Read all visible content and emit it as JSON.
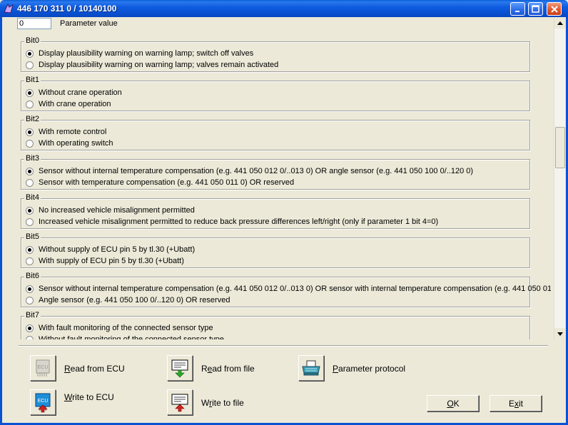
{
  "window": {
    "title": "446 170 311 0 / 10140100"
  },
  "parameter": {
    "value": "0",
    "label": "Parameter value"
  },
  "bits": [
    {
      "title": "Bit0",
      "options": [
        {
          "label": "Display plausibility warning on warning lamp; switch off valves",
          "selected": true
        },
        {
          "label": "Display plausibility warning on warning lamp; valves remain activated",
          "selected": false
        }
      ]
    },
    {
      "title": "Bit1",
      "options": [
        {
          "label": "Without crane operation",
          "selected": true
        },
        {
          "label": "With crane operation",
          "selected": false
        }
      ]
    },
    {
      "title": "Bit2",
      "options": [
        {
          "label": "With remote control",
          "selected": true
        },
        {
          "label": "With operating switch",
          "selected": false
        }
      ]
    },
    {
      "title": "Bit3",
      "options": [
        {
          "label": "Sensor without internal temperature compensation (e.g. 441 050 012 0/..013 0) OR angle sensor (e.g. 441 050 100 0/..120 0)",
          "selected": true
        },
        {
          "label": "Sensor with temperature compensation (e.g. 441 050 011 0) OR reserved",
          "selected": false
        }
      ]
    },
    {
      "title": "Bit4",
      "options": [
        {
          "label": "No increased vehicle misalignment permitted",
          "selected": true
        },
        {
          "label": "Increased vehicle misalignment permitted to reduce back pressure differences left/right (only if parameter 1 bit 4=0)",
          "selected": false
        }
      ]
    },
    {
      "title": "Bit5",
      "options": [
        {
          "label": "Without supply of ECU pin 5 by tl.30 (+Ubatt)",
          "selected": true
        },
        {
          "label": "With supply of ECU pin 5 by tl.30 (+Ubatt)",
          "selected": false
        }
      ]
    },
    {
      "title": "Bit6",
      "options": [
        {
          "label": "Sensor without internal temperature compensation (e.g. 441 050 012 0/..013 0) OR sensor with internal temperature compensation (e.g. 441 050 01",
          "selected": true
        },
        {
          "label": "Angle sensor (e.g. 441 050 100 0/..120 0) OR reserved",
          "selected": false
        }
      ]
    },
    {
      "title": "Bit7",
      "options": [
        {
          "label": "With fault monitoring of the connected sensor type",
          "selected": true
        },
        {
          "label": "Without fault monitoring of the connected sensor type",
          "selected": false
        }
      ]
    }
  ],
  "actions": {
    "read_ecu": {
      "accel": "R",
      "rest": "ead from ECU"
    },
    "write_ecu": {
      "accel": "W",
      "rest": "rite to ECU"
    },
    "read_file": {
      "pre": "R",
      "accel": "e",
      "rest": "ad from file"
    },
    "write_file": {
      "pre": "W",
      "accel": "r",
      "rest": "ite to file"
    },
    "protocol": {
      "accel": "P",
      "rest": "arameter protocol"
    },
    "ok": {
      "accel": "O",
      "rest": "K"
    },
    "exit": {
      "pre": "E",
      "accel": "x",
      "rest": "it"
    }
  },
  "scrollbar": {
    "position_fraction": 0.38
  },
  "colors": {
    "titlebar": "#0a52d4",
    "face": "#ece9d8"
  }
}
